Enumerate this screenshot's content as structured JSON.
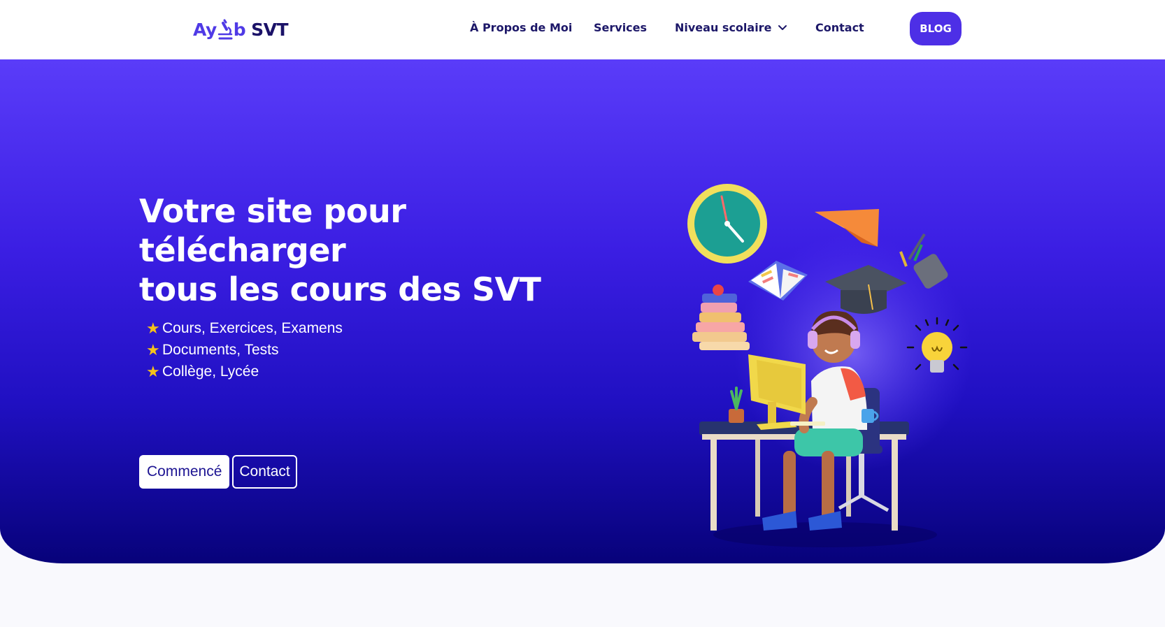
{
  "brand": {
    "logo_prefix": "Ay",
    "logo_suffix": "b",
    "logo_name": "SVT",
    "logo_icon": "microscope-icon",
    "colors": {
      "primary": "#4d2fe6",
      "navy": "#1c1768",
      "star": "#f6c21a"
    }
  },
  "nav": {
    "about": "À Propos de Moi",
    "services": "Services",
    "levels": "Niveau scolaire",
    "contact": "Contact",
    "blog": "BLOG"
  },
  "hero": {
    "title_lines": [
      "Votre site pour",
      "télécharger",
      "tous les cours des SVT"
    ],
    "features": [
      "Cours, Exercices, Examens",
      "Documents, Tests",
      "Collège, Lycée"
    ],
    "start_button": "Commencé",
    "contact_button": "Contact"
  }
}
